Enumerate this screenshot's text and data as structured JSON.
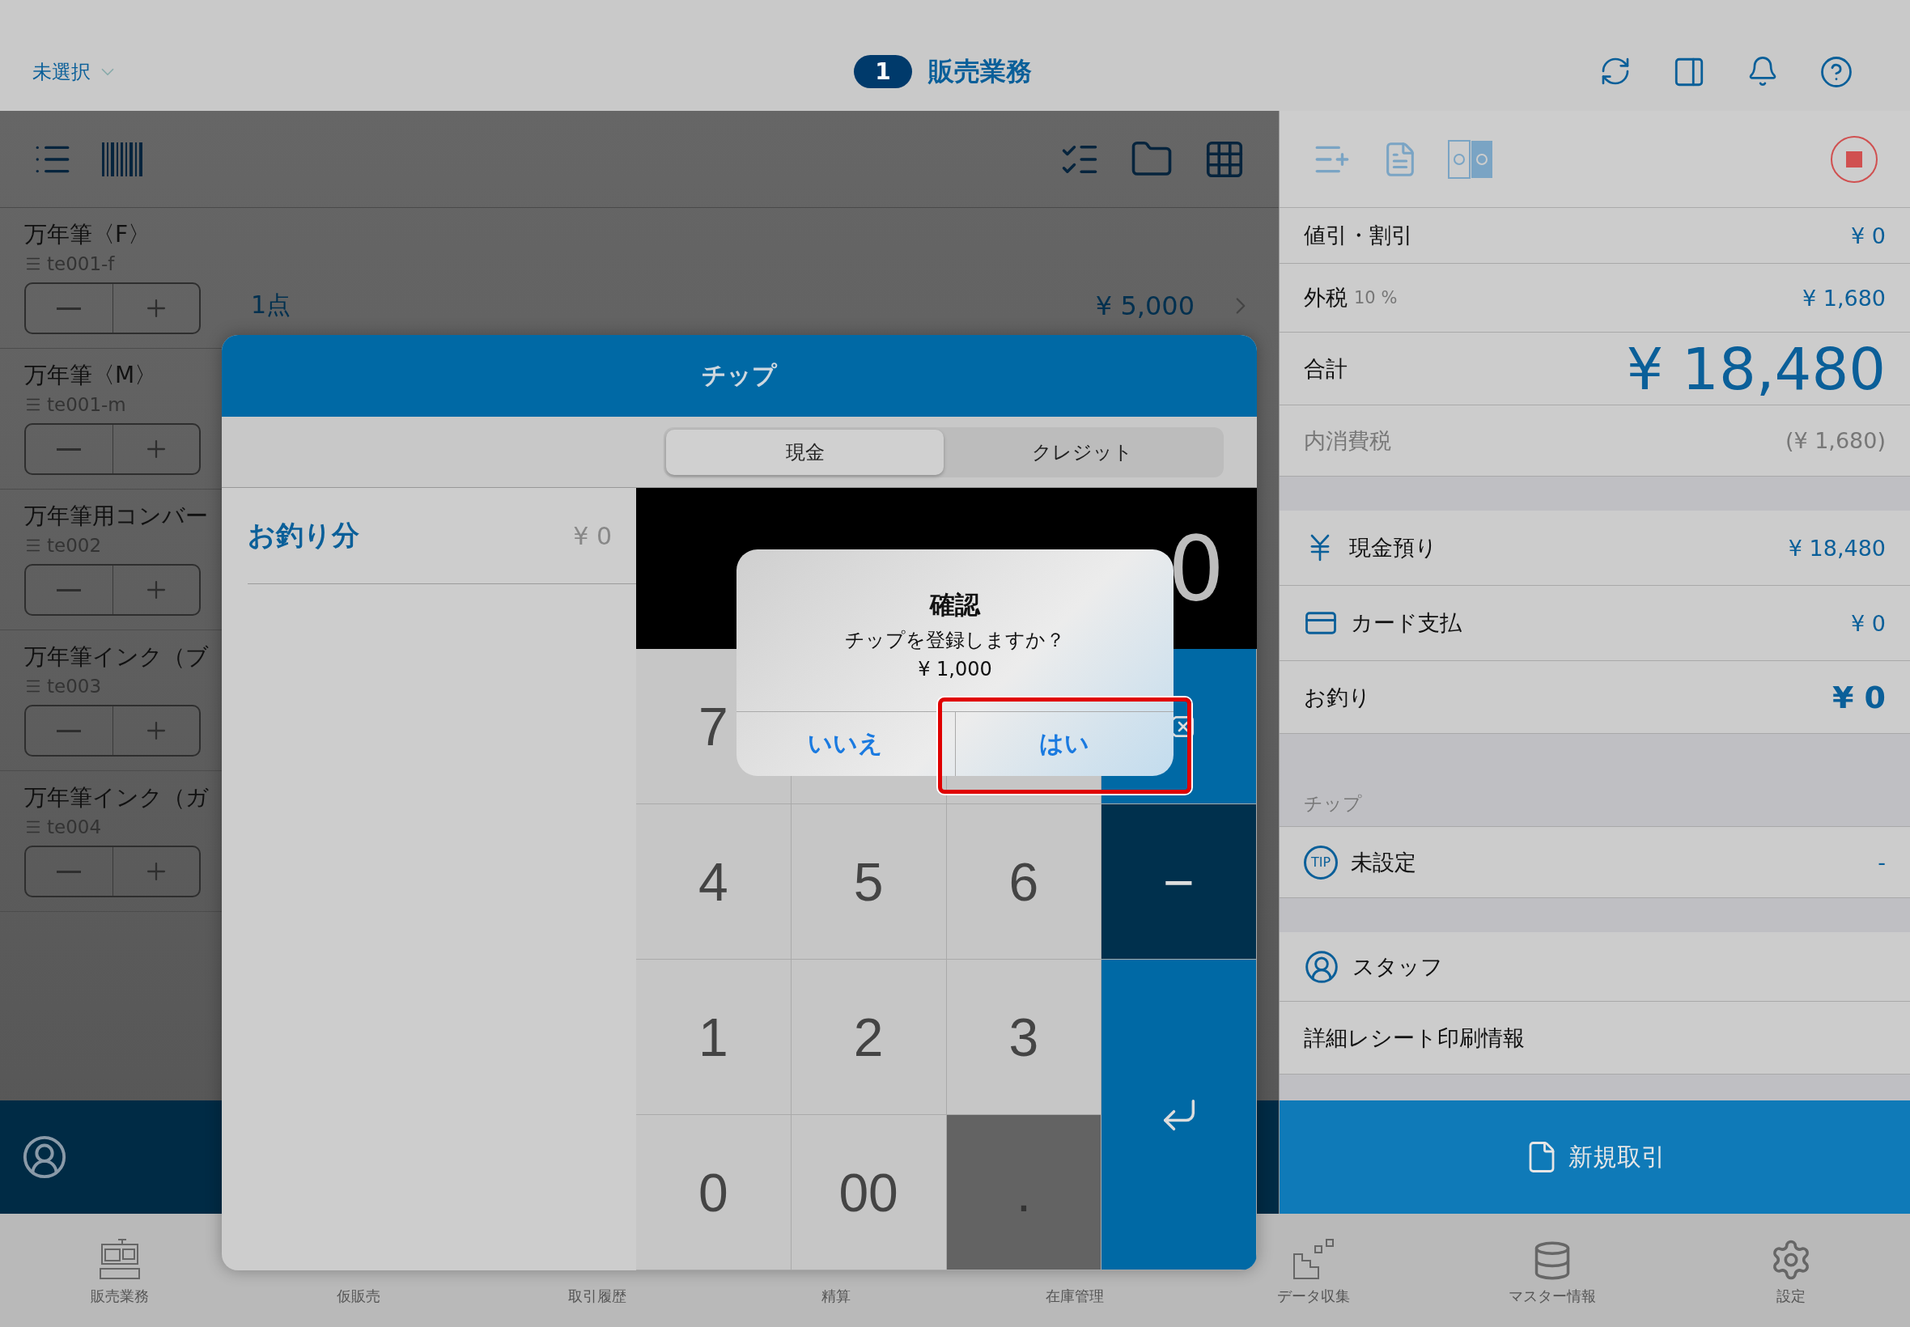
{
  "header": {
    "store_selector": "未選択",
    "badge": "1",
    "title": "販売業務"
  },
  "products": [
    {
      "name": "万年筆〈F〉",
      "code": "te001-f"
    },
    {
      "name": "万年筆〈M〉",
      "code": "te001-m"
    },
    {
      "name": "万年筆用コンバー",
      "code": "te002"
    },
    {
      "name": "万年筆インク（ブ",
      "code": "te003"
    },
    {
      "name": "万年筆インク（ガ",
      "code": "te004"
    }
  ],
  "cart_line": {
    "count": "1点",
    "amount": "¥ 5,000"
  },
  "summary": [
    {
      "kind": "line",
      "label": "値引・割引",
      "value": "¥ 0"
    },
    {
      "kind": "line",
      "label": "外税",
      "note": "10 %",
      "value": "¥ 1,680"
    },
    {
      "kind": "total",
      "label": "合計",
      "value": "¥ 18,480"
    },
    {
      "kind": "sub",
      "label": "内消費税",
      "value": "(¥ 1,680)"
    }
  ],
  "payments": [
    {
      "kind": "cash",
      "label": "現金預り",
      "value": "¥ 18,480"
    },
    {
      "kind": "card",
      "label": "カード支払",
      "value": "¥ 0"
    },
    {
      "kind": "change",
      "label": "お釣り",
      "value": "¥ 0"
    }
  ],
  "tip_section": {
    "heading": "チップ",
    "icon_text": "TIP",
    "label": "未設定",
    "value": "-"
  },
  "staff": {
    "label": "スタッフ"
  },
  "receipt_info": {
    "label": "詳細レシート印刷情報"
  },
  "new_transaction_button": "新規取引",
  "tabs": [
    {
      "label": "販売業務"
    },
    {
      "label": "仮販売"
    },
    {
      "label": "取引履歴"
    },
    {
      "label": "精算"
    },
    {
      "label": "在庫管理"
    },
    {
      "label": "データ収集"
    },
    {
      "label": "マスター情報"
    },
    {
      "label": "設定"
    }
  ],
  "tip_dialog": {
    "title": "チップ",
    "segments": [
      {
        "label": "現金",
        "selected": true
      },
      {
        "label": "クレジット",
        "selected": false
      }
    ],
    "change_label": "お釣り分",
    "change_value": "¥ 0",
    "display": "0",
    "keys": [
      {
        "kind": "digit",
        "label": "7"
      },
      {
        "kind": "blank"
      },
      {
        "kind": "blank"
      },
      {
        "kind": "backspace"
      },
      {
        "kind": "digit",
        "label": "4"
      },
      {
        "kind": "digit",
        "label": "5"
      },
      {
        "kind": "digit",
        "label": "6"
      },
      {
        "kind": "minus",
        "label": "−"
      },
      {
        "kind": "digit",
        "label": "1"
      },
      {
        "kind": "digit",
        "label": "2"
      },
      {
        "kind": "digit",
        "label": "3"
      },
      {
        "kind": "enter"
      },
      {
        "kind": "digit",
        "label": "0"
      },
      {
        "kind": "digit",
        "label": "00"
      },
      {
        "kind": "digit",
        "label": ".",
        "disabled": true
      }
    ]
  },
  "alert": {
    "title": "確認",
    "message": "チップを登録しますか？",
    "amount": "¥ 1,000",
    "buttons": [
      {
        "label": "いいえ",
        "highlighted": false
      },
      {
        "label": "はい",
        "highlighted": true
      }
    ]
  }
}
